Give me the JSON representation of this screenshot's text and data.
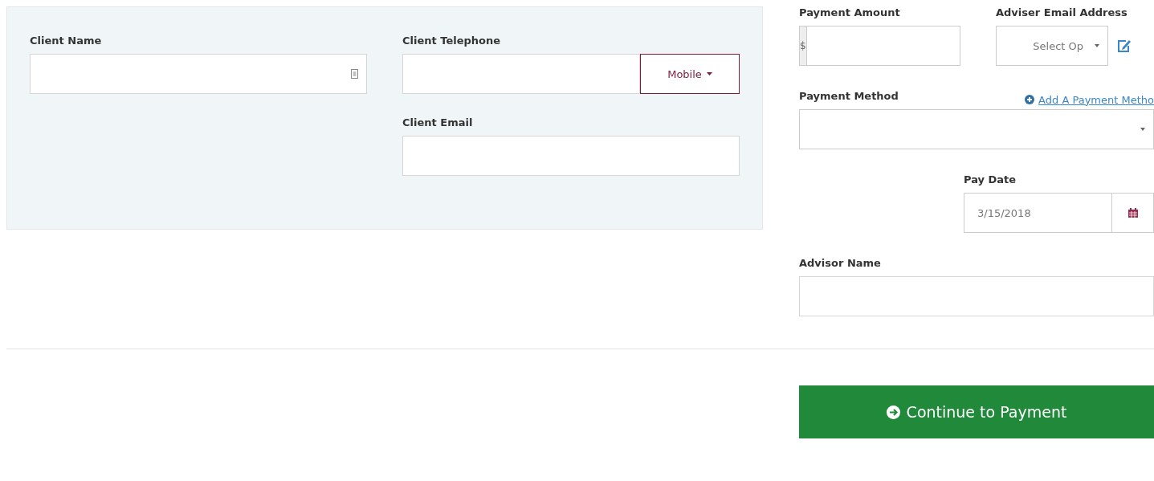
{
  "client": {
    "name_label": "Client Name",
    "telephone_label": "Client Telephone",
    "phone_type": "Mobile",
    "email_label": "Client Email"
  },
  "payment": {
    "amount_label": "Payment Amount",
    "currency": "$",
    "advisor_email_label": "Adviser Email Address",
    "advisor_email_placeholder": "Select Op",
    "method_label": "Payment Method",
    "add_method_link": "Add A Payment Metho",
    "pay_date_label": "Pay Date",
    "pay_date": "3/15/2018",
    "advisor_name_label": "Advisor Name"
  },
  "continue_button": "Continue to Payment"
}
